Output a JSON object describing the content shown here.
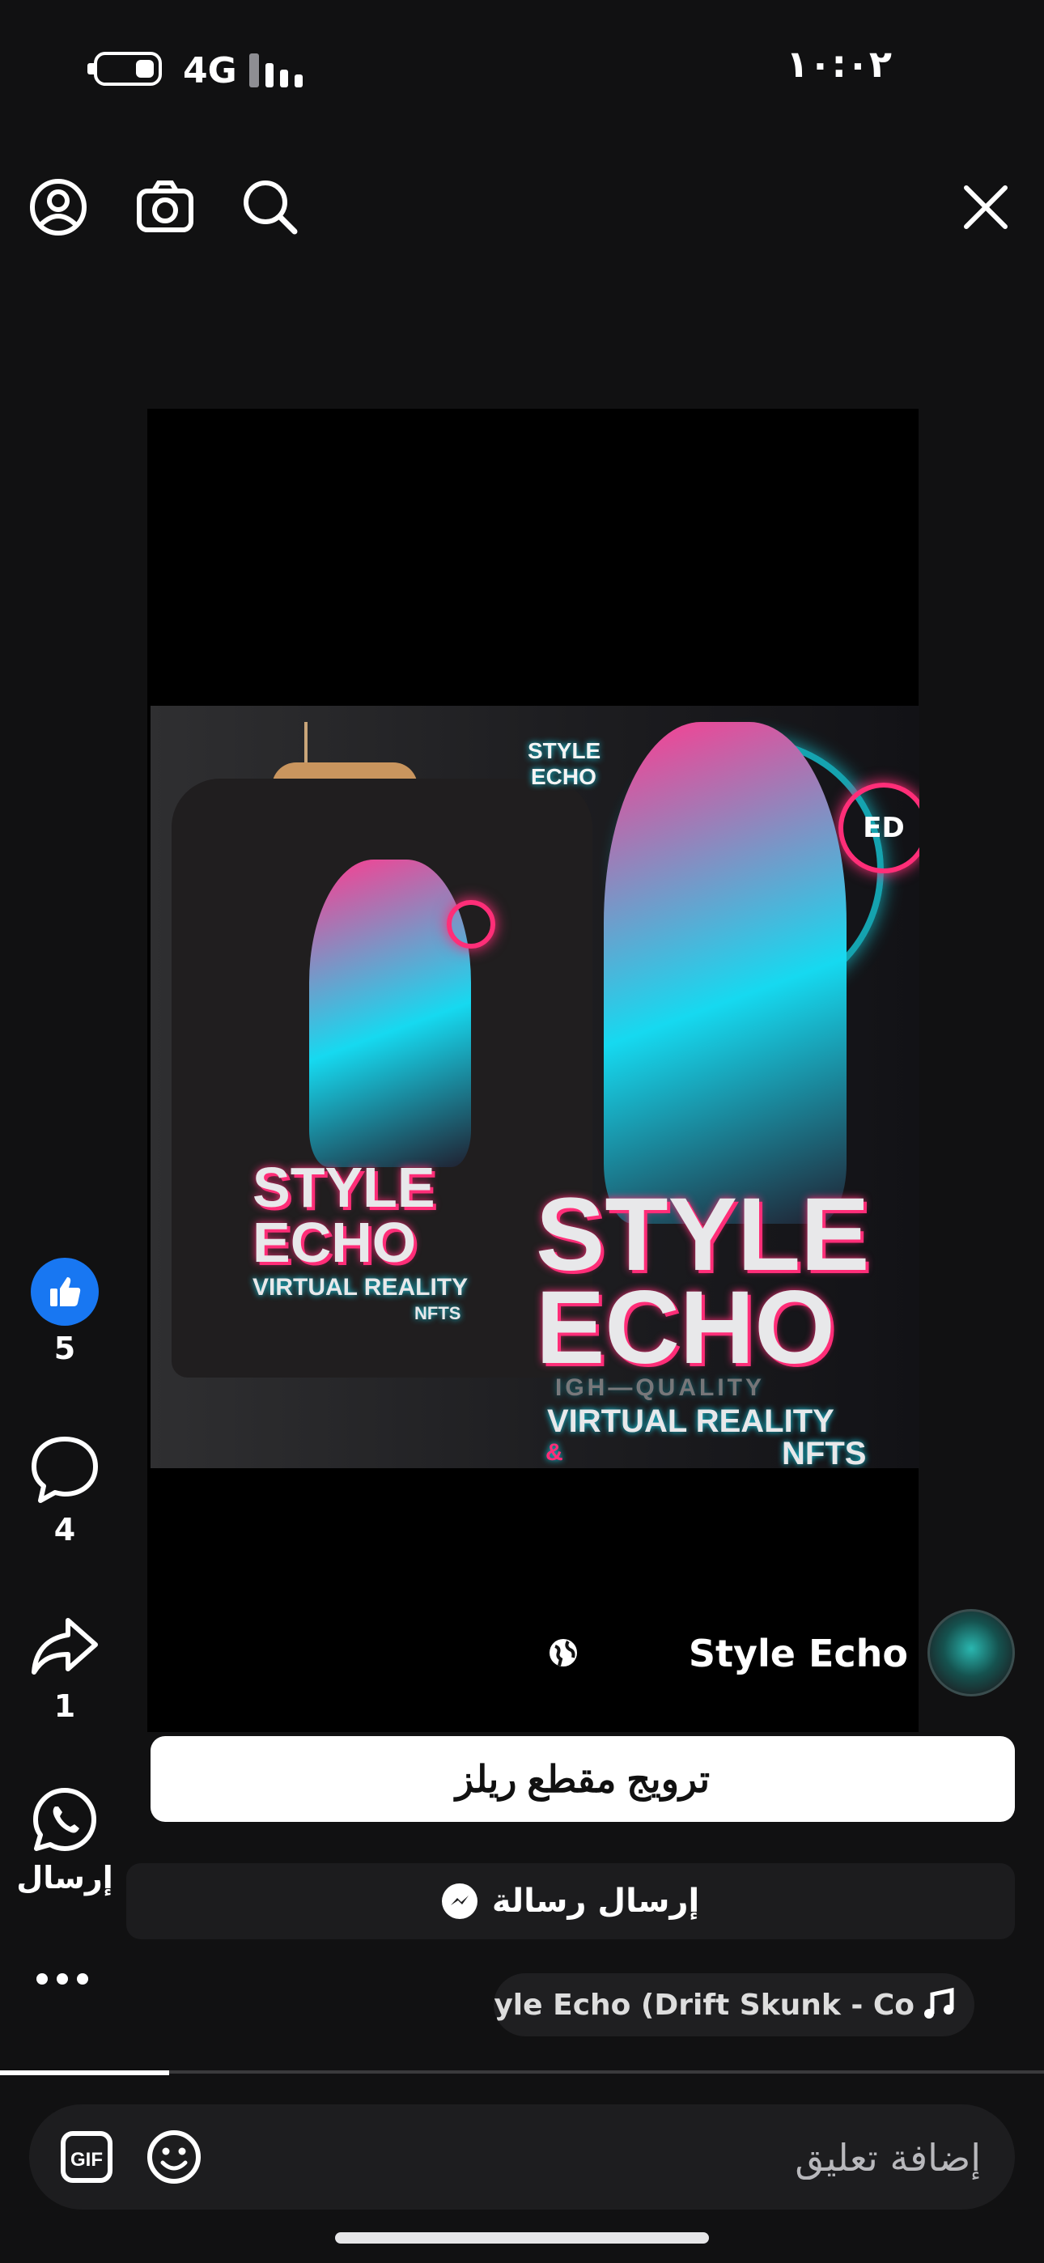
{
  "status_bar": {
    "time": "١٠:٠٢",
    "network": "4G"
  },
  "top_bar": {
    "icons": [
      "profile-icon",
      "camera-icon",
      "search-icon",
      "close-icon"
    ]
  },
  "media": {
    "art": {
      "brand_small": [
        "STYLE",
        "ECHO"
      ],
      "title_large": [
        "STYLE",
        "ECHO"
      ],
      "subtitle_faded": "IGH—QUALITY",
      "line1": "VIRTUAL REALITY",
      "line2": "NFTS",
      "amp": "&",
      "badge": "ED",
      "shirt_title": [
        "STYLE",
        "ECHO"
      ],
      "shirt_line1": "VIRTUAL REALITY",
      "shirt_line2": "NFTS"
    }
  },
  "actions": {
    "likes": "5",
    "comments": "4",
    "shares": "1",
    "send_label": "إرسال"
  },
  "author": {
    "name": "Style Echo"
  },
  "buttons": {
    "promote": "ترويج مقطع ريلز",
    "send_message": "إرسال رسالة"
  },
  "audio": {
    "text": "yle Echo    (Drift Skunk - Co"
  },
  "playback": {
    "progress": 0.162
  },
  "comment": {
    "placeholder": "إضافة تعليق"
  },
  "colors": {
    "accent_blue": "#1877f2",
    "neon_cyan": "#16e0f0",
    "neon_pink": "#ff2e78"
  }
}
